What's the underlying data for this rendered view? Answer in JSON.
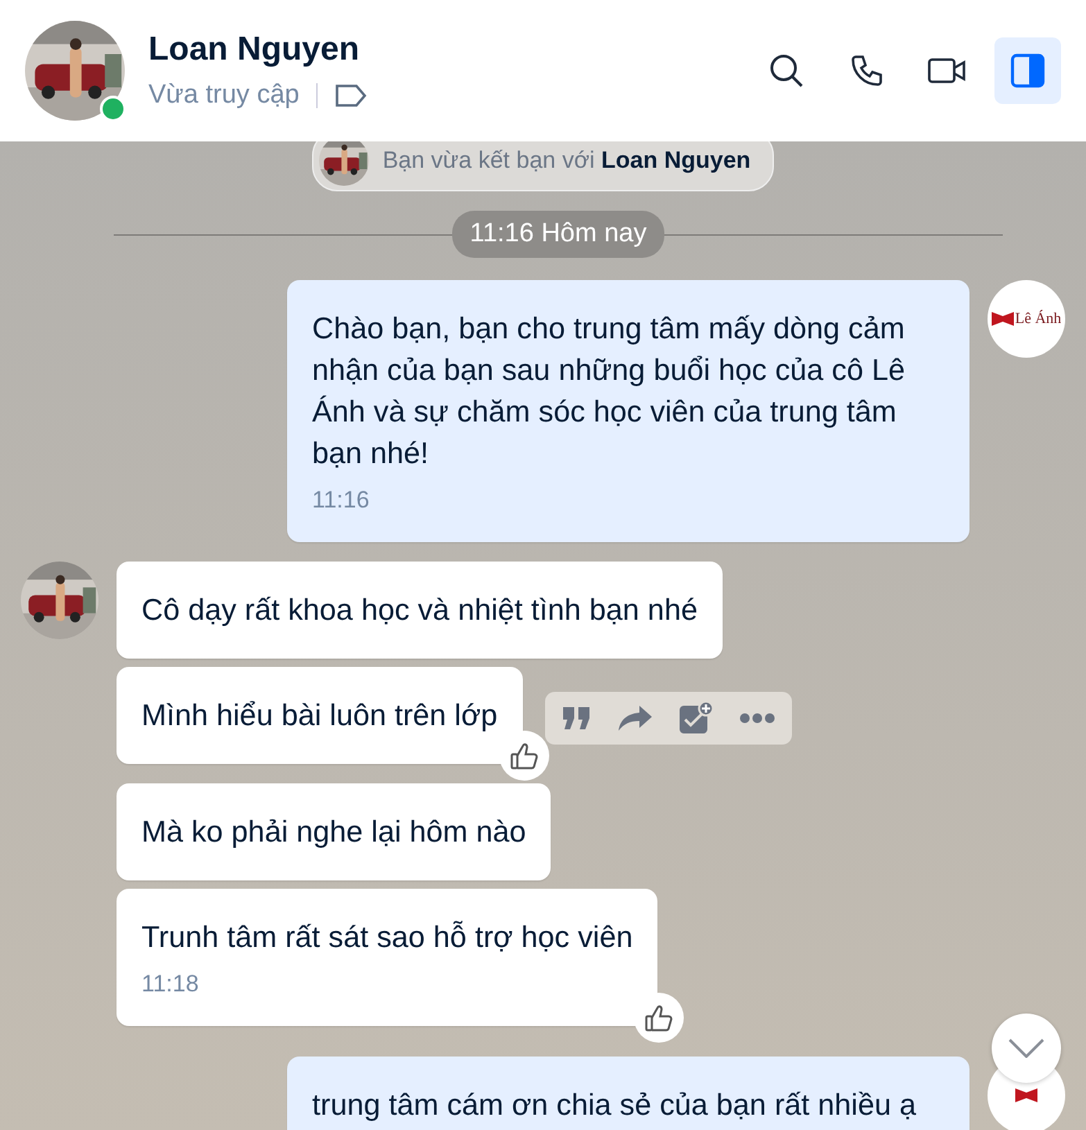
{
  "header": {
    "name": "Loan Nguyen",
    "status": "Vừa truy cập",
    "online": true,
    "actions": [
      {
        "kind": "search",
        "selected": false
      },
      {
        "kind": "phone",
        "selected": false
      },
      {
        "kind": "video",
        "selected": false
      },
      {
        "kind": "panel",
        "selected": true
      }
    ]
  },
  "system_notice": {
    "text": "Bạn vừa kết bạn với",
    "name": "Loan Nguyen"
  },
  "time_divider": "11:16 Hôm nay",
  "messages": [
    {
      "kind": "outgoing",
      "text": "Chào bạn, bạn cho trung tâm mấy dòng cảm nhận của bạn sau những buổi học của cô Lê Ánh và sự chăm sóc học viên của trung tâm bạn nhé!",
      "time": "11:16",
      "avatar": {
        "kind": "logo",
        "text": "Lê Ánh"
      },
      "liked": false,
      "toolbar": false
    },
    {
      "kind": "incoming",
      "text": "Cô dạy rất khoa học và nhiệt tình bạn nhé",
      "liked": false,
      "toolbar": false
    },
    {
      "kind": "incoming",
      "text": "Mình hiểu bài luôn trên lớp",
      "liked": true,
      "toolbar": true
    },
    {
      "kind": "incoming",
      "text": "Mà ko phải nghe lại hôm nào",
      "liked": false,
      "toolbar": false
    },
    {
      "kind": "incoming",
      "text": "Trunh tâm rất sát sao hỗ trợ học viên",
      "time": "11:18",
      "liked": true,
      "toolbar": false
    },
    {
      "kind": "outgoing",
      "text": "trung tâm cám ơn chia sẻ của bạn rất nhiều ạ",
      "avatar": {
        "kind": "logo"
      },
      "liked": false,
      "toolbar": false
    }
  ]
}
